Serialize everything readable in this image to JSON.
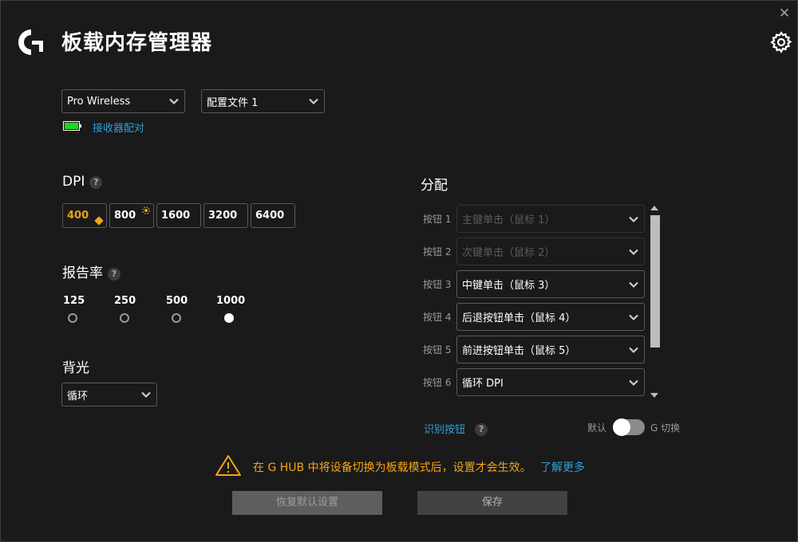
{
  "header": {
    "title": "板载内存管理器",
    "logo_icon": "logitech-g-logo",
    "close_icon": "close-icon",
    "settings_icon": "gear-icon"
  },
  "device": {
    "selected": "Pro Wireless",
    "profile": "配置文件 1",
    "battery_icon": "battery-icon",
    "battery_level": "full",
    "pair_link": "接收器配对"
  },
  "dpi": {
    "label": "DPI",
    "help": "?",
    "values": [
      "400",
      "800",
      "1600",
      "3200",
      "6400"
    ],
    "active_index": 0,
    "default_marker_index": 0,
    "shift_marker_index": 1
  },
  "report_rate": {
    "label": "报告率",
    "help": "?",
    "options": [
      "125",
      "250",
      "500",
      "1000"
    ],
    "selected": "1000"
  },
  "lighting": {
    "label": "背光",
    "selected": "循环"
  },
  "assignments": {
    "label": "分配",
    "rows": [
      {
        "label": "按钮 1",
        "value": "主键单击（鼠标 1）",
        "disabled": true
      },
      {
        "label": "按钮 2",
        "value": "次键单击（鼠标 2）",
        "disabled": true
      },
      {
        "label": "按钮 3",
        "value": "中键单击（鼠标 3）",
        "disabled": false
      },
      {
        "label": "按钮 4",
        "value": "后退按钮单击（鼠标 4）",
        "disabled": false
      },
      {
        "label": "按钮 5",
        "value": "前进按钮单击（鼠标 5）",
        "disabled": false
      },
      {
        "label": "按钮 6",
        "value": "循环 DPI",
        "disabled": false
      }
    ],
    "identify_link": "识别按钮",
    "help": "?",
    "toggle_left": "默认",
    "toggle_right": "G 切换",
    "toggle_state": "默认"
  },
  "warning": {
    "icon": "warning-icon",
    "text": "在 G HUB 中将设备切换为板载模式后，设置才会生效。",
    "link": "了解更多"
  },
  "footer": {
    "reset_label": "恢复默认设置",
    "save_label": "保存"
  }
}
